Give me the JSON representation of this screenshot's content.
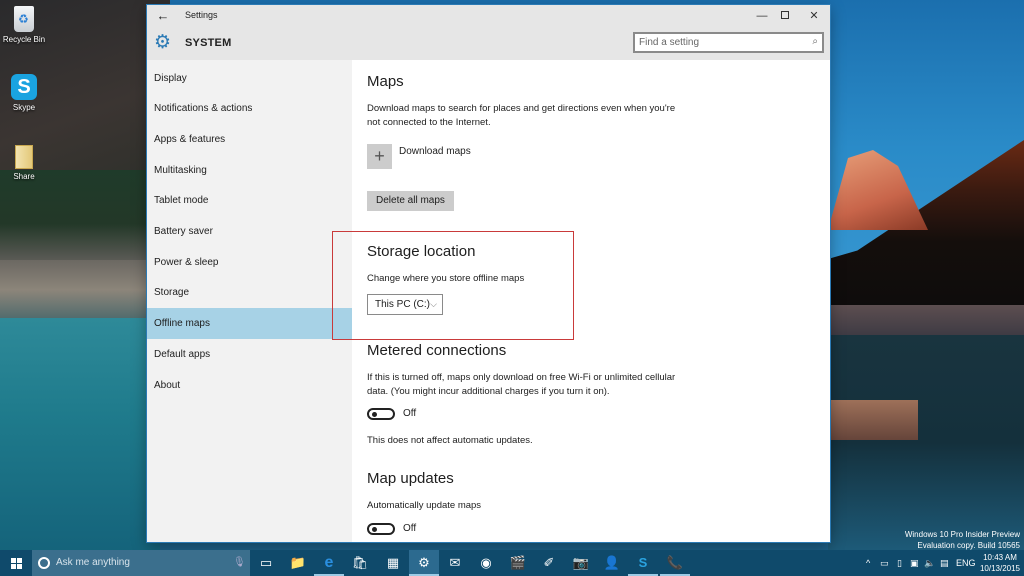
{
  "desktop": {
    "icons": [
      {
        "label": "Recycle Bin",
        "icon": "recycle-bin-icon"
      },
      {
        "label": "Skype",
        "icon": "skype-icon"
      },
      {
        "label": "Share",
        "icon": "folder-icon"
      }
    ],
    "watermark": {
      "line1": "Windows 10 Pro Insider Preview",
      "line2": "Evaluation copy. Build 10565"
    }
  },
  "window": {
    "title": "Settings",
    "back_glyph": "←",
    "controls": {
      "minimize": "—",
      "close": "✕"
    },
    "header": {
      "section": "SYSTEM",
      "gear_glyph": "⚙",
      "search_placeholder": "Find a setting",
      "search_glyph": "⌕"
    },
    "sidebar": {
      "items": [
        {
          "label": "Display",
          "active": false
        },
        {
          "label": "Notifications & actions",
          "active": false
        },
        {
          "label": "Apps & features",
          "active": false
        },
        {
          "label": "Multitasking",
          "active": false
        },
        {
          "label": "Tablet mode",
          "active": false
        },
        {
          "label": "Battery saver",
          "active": false
        },
        {
          "label": "Power & sleep",
          "active": false
        },
        {
          "label": "Storage",
          "active": false
        },
        {
          "label": "Offline maps",
          "active": true
        },
        {
          "label": "Default apps",
          "active": false
        },
        {
          "label": "About",
          "active": false
        }
      ]
    },
    "content": {
      "maps": {
        "heading": "Maps",
        "description": "Download maps to search for places and get directions even when you're not connected to the Internet.",
        "download_glyph": "+",
        "download_label": "Download maps",
        "delete_label": "Delete all maps"
      },
      "storage": {
        "heading": "Storage location",
        "description": "Change where you store offline maps",
        "selected": "This PC (C:)",
        "chevron": "⌵"
      },
      "metered": {
        "heading": "Metered connections",
        "description": "If this is turned off, maps only download on free Wi-Fi or unlimited cellular data. (You might incur additional charges if you turn it on).",
        "toggle_state": "Off",
        "note": "This does not affect automatic updates."
      },
      "updates": {
        "heading": "Map updates",
        "description": "Automatically update maps",
        "toggle_state": "Off"
      }
    }
  },
  "taskbar": {
    "search_placeholder": "Ask me anything",
    "mic_glyph": "🎙",
    "apps": [
      {
        "name": "task-view",
        "glyph": "▭",
        "state": ""
      },
      {
        "name": "file-explorer",
        "glyph": "📁",
        "state": ""
      },
      {
        "name": "edge",
        "glyph": "e",
        "state": "running"
      },
      {
        "name": "store",
        "glyph": "🛍",
        "state": ""
      },
      {
        "name": "calculator",
        "glyph": "▦",
        "state": ""
      },
      {
        "name": "settings",
        "glyph": "⚙",
        "state": "active"
      },
      {
        "name": "mail",
        "glyph": "✉",
        "state": ""
      },
      {
        "name": "maps-webcam",
        "glyph": "◉",
        "state": ""
      },
      {
        "name": "movies",
        "glyph": "🎬",
        "state": ""
      },
      {
        "name": "get-started",
        "glyph": "✐",
        "state": ""
      },
      {
        "name": "camera",
        "glyph": "📷",
        "state": ""
      },
      {
        "name": "people",
        "glyph": "👤",
        "state": ""
      },
      {
        "name": "skype",
        "glyph": "S",
        "state": "running"
      },
      {
        "name": "phone",
        "glyph": "📞",
        "state": "running"
      }
    ],
    "tray": {
      "chevron": "^",
      "battery": "▭",
      "usb": "▯",
      "network": "▣",
      "volume": "🔈",
      "notifications": "▤",
      "language": "ENG",
      "time": "10:43 AM",
      "date": "10/13/2015"
    }
  }
}
